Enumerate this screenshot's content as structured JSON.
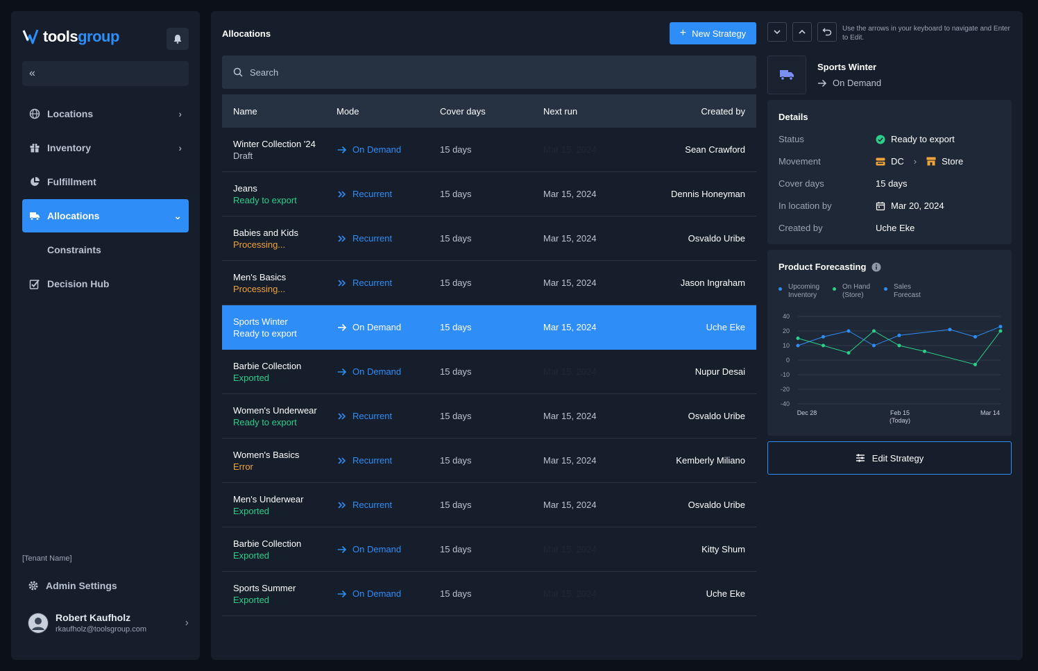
{
  "app": {
    "logo_prefix": "tools",
    "logo_suffix": "group"
  },
  "sidebar": {
    "items": [
      {
        "label": "Locations"
      },
      {
        "label": "Inventory"
      },
      {
        "label": "Fulfillment"
      },
      {
        "label": "Allocations"
      },
      {
        "label": "Constraints"
      },
      {
        "label": "Decision Hub"
      }
    ],
    "tenant": "[Tenant Name]",
    "admin": "Admin Settings",
    "user": {
      "name": "Robert Kaufholz",
      "email": "rkaufholz@toolsgroup.com"
    }
  },
  "main": {
    "title": "Allocations",
    "new_button": "New Strategy",
    "search_placeholder": "Search",
    "columns": [
      "Name",
      "Mode",
      "Cover days",
      "Next run",
      "Created by"
    ],
    "rows": [
      {
        "name": "Winter Collection '24",
        "status": "Draft",
        "status_type": "draft",
        "mode": "On Demand",
        "cover": "15 days",
        "next": "Mar 15, 2024",
        "next_dim": true,
        "creator": "Sean Crawford"
      },
      {
        "name": "Jeans",
        "status": "Ready to export",
        "status_type": "ready",
        "mode": "Recurrent",
        "cover": "15 days",
        "next": "Mar 15, 2024",
        "next_dim": false,
        "creator": "Dennis Honeyman"
      },
      {
        "name": "Babies and Kids",
        "status": "Processing...",
        "status_type": "proc",
        "mode": "Recurrent",
        "cover": "15 days",
        "next": "Mar 15, 2024",
        "next_dim": false,
        "creator": "Osvaldo Uribe"
      },
      {
        "name": "Men's Basics",
        "status": "Processing...",
        "status_type": "proc",
        "mode": "Recurrent",
        "cover": "15 days",
        "next": "Mar 15, 2024",
        "next_dim": false,
        "creator": "Jason Ingraham"
      },
      {
        "name": "Sports Winter",
        "status": "Ready to export",
        "status_type": "ready",
        "mode": "On Demand",
        "cover": "15 days",
        "next": "Mar 15, 2024",
        "next_dim": false,
        "creator": "Uche Eke",
        "selected": true
      },
      {
        "name": "Barbie Collection",
        "status": "Exported",
        "status_type": "exp",
        "mode": "On Demand",
        "cover": "15 days",
        "next": "Mar 15, 2024",
        "next_dim": true,
        "creator": "Nupur Desai"
      },
      {
        "name": "Women's Underwear",
        "status": "Ready to export",
        "status_type": "ready",
        "mode": "Recurrent",
        "cover": "15 days",
        "next": "Mar 15, 2024",
        "next_dim": false,
        "creator": "Osvaldo Uribe"
      },
      {
        "name": "Women's Basics",
        "status": "Error",
        "status_type": "err",
        "mode": "Recurrent",
        "cover": "15 days",
        "next": "Mar 15, 2024",
        "next_dim": false,
        "creator": "Kemberly Miliano"
      },
      {
        "name": "Men's Underwear",
        "status": "Exported",
        "status_type": "exp",
        "mode": "Recurrent",
        "cover": "15 days",
        "next": "Mar 15, 2024",
        "next_dim": false,
        "creator": "Osvaldo Uribe"
      },
      {
        "name": "Barbie Collection",
        "status": "Exported",
        "status_type": "exp",
        "mode": "On Demand",
        "cover": "15 days",
        "next": "Mar 15, 2024",
        "next_dim": true,
        "creator": "Kitty Shum"
      },
      {
        "name": "Sports Summer",
        "status": "Exported",
        "status_type": "exp",
        "mode": "On Demand",
        "cover": "15 days",
        "next": "Mar 15, 2024",
        "next_dim": true,
        "creator": "Uche Eke"
      }
    ]
  },
  "panel": {
    "hint": "Use the arrows in your keyboard to navigate and Enter to Edit.",
    "title": "Sports Winter",
    "mode": "On Demand",
    "details_title": "Details",
    "details": {
      "status_label": "Status",
      "status_value": "Ready to export",
      "movement_label": "Movement",
      "movement_from": "DC",
      "movement_to": "Store",
      "cover_label": "Cover days",
      "cover_value": "15 days",
      "inloc_label": "In location by",
      "inloc_value": "Mar 20, 2024",
      "created_label": "Created by",
      "created_value": "Uche Eke"
    },
    "forecast_title": "Product Forecasting",
    "edit_button": "Edit Strategy"
  },
  "chart_data": {
    "type": "line",
    "title": "Product Forecasting",
    "x": [
      "Dec 28",
      "",
      "",
      "",
      "Feb 15 (Today)",
      "",
      "",
      "",
      "Mar 14"
    ],
    "x_ticks": [
      "Dec 28",
      "Feb 15",
      "(Today)",
      "Mar 14"
    ],
    "y_ticks": [
      40,
      20,
      10,
      0,
      -10,
      -20,
      -40
    ],
    "ylim": [
      -40,
      40
    ],
    "legend": [
      "Upcoming\nInventory",
      "On Hand\n(Store)",
      "Sales\nForecast"
    ],
    "series": [
      {
        "name": "Upcoming Inventory",
        "color": "#2f8df7",
        "values": [
          10,
          16,
          20,
          10,
          17,
          null,
          22,
          16,
          26
        ]
      },
      {
        "name": "On Hand (Store)",
        "color": "#2bcf8a",
        "values": [
          15,
          10,
          5,
          20,
          10,
          6,
          null,
          -3,
          20
        ]
      },
      {
        "name": "Sales Forecast",
        "color": "#2f8df7",
        "values": []
      }
    ]
  },
  "colors": {
    "accent": "#2f8df7",
    "success": "#2bcf8a",
    "warning": "#f2a33a"
  }
}
